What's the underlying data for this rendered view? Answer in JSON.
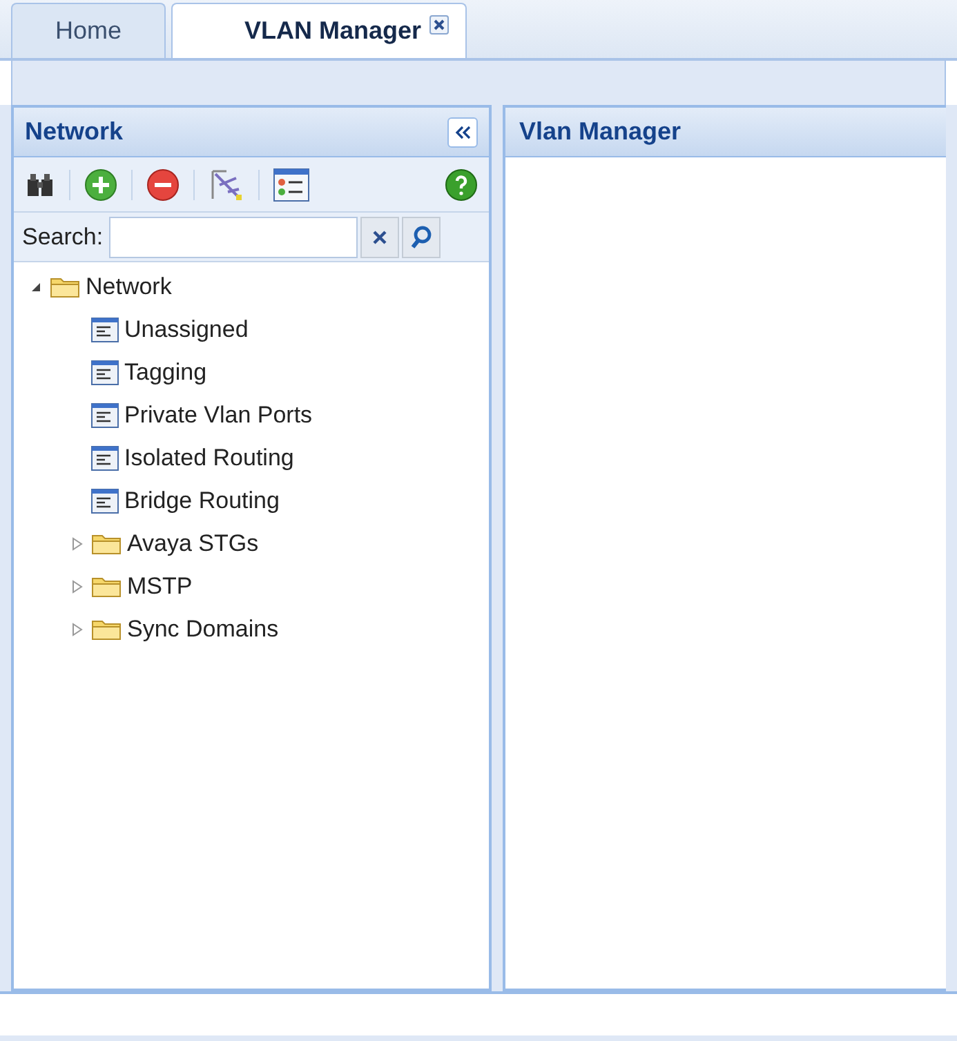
{
  "tabs": [
    {
      "label": "Home",
      "selected": false,
      "closable": false
    },
    {
      "label": "VLAN Manager",
      "selected": true,
      "closable": true
    }
  ],
  "left_panel": {
    "title": "Network",
    "search": {
      "label": "Search:"
    },
    "tree": [
      {
        "label": "Network",
        "kind": "folder",
        "expanded": true,
        "children": [
          {
            "label": "Unassigned",
            "kind": "list"
          },
          {
            "label": "Tagging",
            "kind": "list"
          },
          {
            "label": "Private Vlan Ports",
            "kind": "list"
          },
          {
            "label": "Isolated Routing",
            "kind": "list"
          },
          {
            "label": "Bridge Routing",
            "kind": "list"
          },
          {
            "label": "Avaya STGs",
            "kind": "folder",
            "expanded": false
          },
          {
            "label": "MSTP",
            "kind": "folder",
            "expanded": false
          },
          {
            "label": "Sync Domains",
            "kind": "folder",
            "expanded": false
          }
        ]
      }
    ]
  },
  "right_panel": {
    "title": "Vlan Manager"
  }
}
